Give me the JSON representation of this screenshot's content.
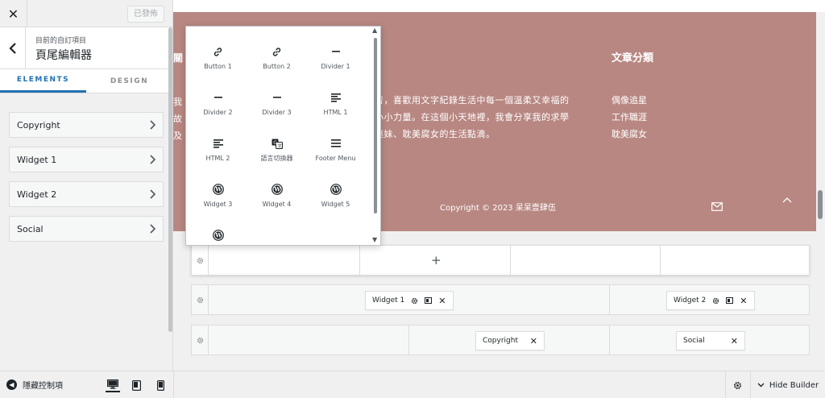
{
  "panel": {
    "close_label": "✕",
    "published_label": "已發佈",
    "breadcrumb": "目前的自訂項目",
    "title": "頁尾編輯器",
    "tabs": [
      {
        "label": "ELEMENTS",
        "active": true
      },
      {
        "label": "DESIGN",
        "active": false
      }
    ],
    "items": [
      {
        "label": "Copyright"
      },
      {
        "label": "Widget 1"
      },
      {
        "label": "Widget 2"
      },
      {
        "label": "Social"
      }
    ]
  },
  "bottombar": {
    "hide_controls_label": "隱藏控制項",
    "hide_builder_label": "Hide Builder",
    "devices": [
      "desktop-icon",
      "tablet-icon",
      "mobile-icon"
    ]
  },
  "preview": {
    "left_heading_fragment": "關",
    "left_text_fragment": [
      "我",
      "故",
      "及"
    ],
    "mid_text": "者，喜歡用文字紀錄生活中每一個溫柔又幸福的小小力量。在這個小天地裡，我會分享我的求學迷妹、耽美腐女的生活點滴。",
    "mid_lines": [
      "者，喜歡用文字紀錄生活中每一個溫柔又幸福的",
      "小小力量。在這個小天地裡，我會分享我的求學",
      "迷妹、耽美腐女的生活點滴。"
    ],
    "category_title": "文章分類",
    "categories": [
      "偶像追星",
      "工作職涯",
      "耽美腐女"
    ],
    "copyright": "Copyright © 2023 呆呆壹肆伍",
    "background_color": "#b88782"
  },
  "builder": {
    "add_label": "+",
    "row2_chips": [
      {
        "label": "Widget 1"
      },
      {
        "label": "Widget 2"
      }
    ],
    "row3_chips": [
      {
        "label": "Copyright"
      },
      {
        "label": "Social"
      }
    ]
  },
  "popup": {
    "items": [
      {
        "label": "Button 1",
        "icon": "link-icon"
      },
      {
        "label": "Button 2",
        "icon": "link-icon"
      },
      {
        "label": "Divider 1",
        "icon": "divider-icon"
      },
      {
        "label": "Divider 2",
        "icon": "divider-icon"
      },
      {
        "label": "Divider 3",
        "icon": "divider-icon"
      },
      {
        "label": "HTML 1",
        "icon": "html-icon"
      },
      {
        "label": "HTML 2",
        "icon": "html-icon"
      },
      {
        "label": "語言切換器",
        "icon": "translate-icon"
      },
      {
        "label": "Footer Menu",
        "icon": "menu-icon"
      },
      {
        "label": "Widget 3",
        "icon": "wordpress-icon"
      },
      {
        "label": "Widget 4",
        "icon": "wordpress-icon"
      },
      {
        "label": "Widget 5",
        "icon": "wordpress-icon"
      },
      {
        "label": "",
        "icon": "wordpress-icon"
      }
    ]
  },
  "colors": {
    "accent": "#2271b1",
    "footer_bg": "#b88782"
  }
}
